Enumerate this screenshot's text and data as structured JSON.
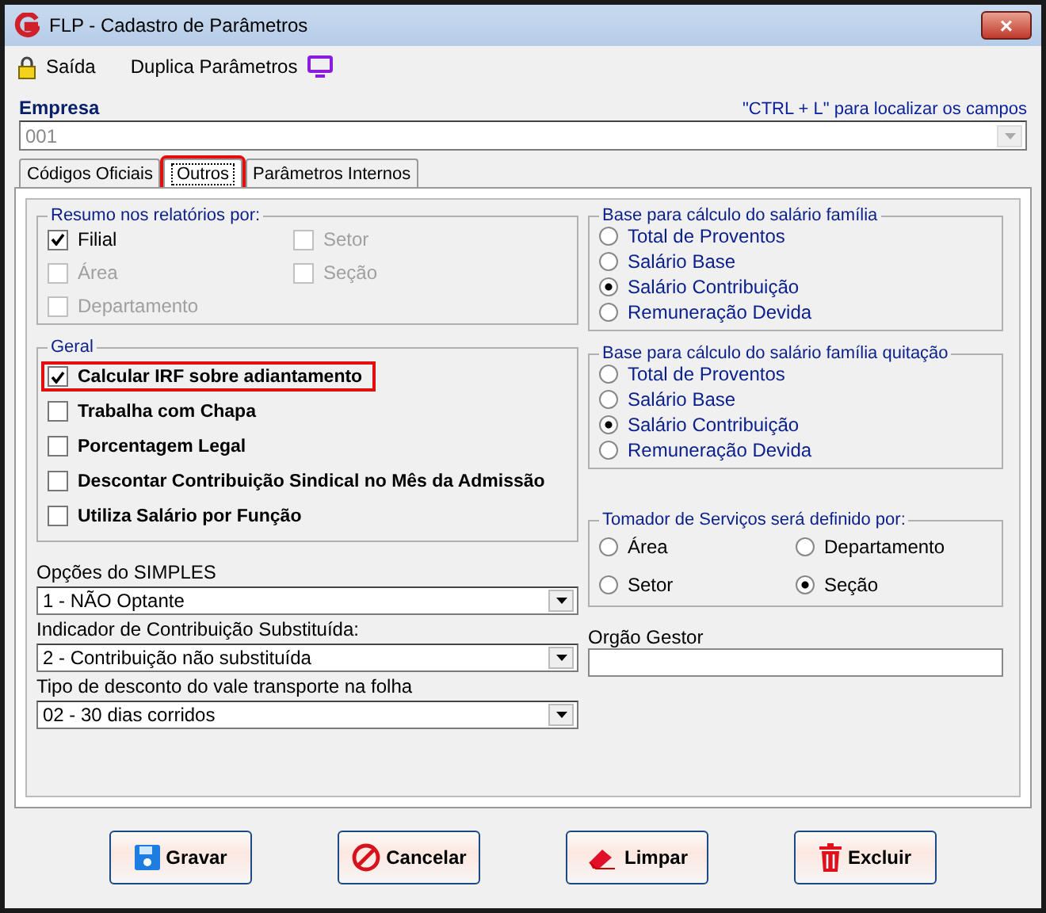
{
  "window": {
    "title": "FLP - Cadastro de Parâmetros",
    "close": "×"
  },
  "toolbar": [
    {
      "label": "Saída",
      "kind": "lock"
    },
    {
      "label": "Duplica Parâmetros",
      "kind": "monitor"
    }
  ],
  "empresa": {
    "label": "Empresa",
    "hint": "\"CTRL + L\" para localizar os campos",
    "value": "001"
  },
  "tabs": [
    {
      "label": "Códigos Oficiais",
      "selected": false,
      "highlighted": false
    },
    {
      "label": "Outros",
      "selected": true,
      "highlighted": true
    },
    {
      "label": "Parâmetros Internos",
      "selected": false,
      "highlighted": false
    }
  ],
  "resumo": {
    "title": "Resumo nos relatórios por:",
    "items": [
      {
        "label": "Filial",
        "checked": true,
        "disabled": false
      },
      {
        "label": "Setor",
        "checked": false,
        "disabled": true
      },
      {
        "label": "Área",
        "checked": false,
        "disabled": true
      },
      {
        "label": "Seção",
        "checked": false,
        "disabled": true
      },
      {
        "label": "Departamento",
        "checked": false,
        "disabled": true
      }
    ]
  },
  "geral": {
    "title": "Geral",
    "items": [
      {
        "label": "Calcular IRF sobre adiantamento",
        "checked": true,
        "highlighted": true
      },
      {
        "label": "Trabalha com Chapa",
        "checked": false,
        "highlighted": false
      },
      {
        "label": "Porcentagem Legal",
        "checked": false,
        "highlighted": false
      },
      {
        "label": "Descontar Contribuição Sindical no Mês da  Admissão",
        "checked": false,
        "highlighted": false
      },
      {
        "label": "Utiliza Salário por Função",
        "checked": false,
        "highlighted": false
      }
    ]
  },
  "dropdowns": [
    {
      "label": "Opções do SIMPLES",
      "value": "1 - NÃO Optante"
    },
    {
      "label": "Indicador de Contribuição Substituída:",
      "value": "2 - Contribuição não substituída"
    },
    {
      "label": "Tipo de desconto do vale transporte na folha",
      "value": "02 - 30 dias corridos"
    }
  ],
  "radio_groups": [
    {
      "title": "Base para cálculo do salário família",
      "kind": "list",
      "options": [
        {
          "label": "Total de Proventos",
          "selected": false
        },
        {
          "label": "Salário Base",
          "selected": false
        },
        {
          "label": "Salário Contribuição",
          "selected": true
        },
        {
          "label": "Remuneração Devida",
          "selected": false
        }
      ]
    },
    {
      "title": "Base para cálculo do salário família quitação",
      "kind": "list",
      "options": [
        {
          "label": "Total de Proventos",
          "selected": false
        },
        {
          "label": "Salário Base",
          "selected": false
        },
        {
          "label": "Salário Contribuição",
          "selected": true
        },
        {
          "label": "Remuneração Devida",
          "selected": false
        }
      ]
    },
    {
      "title": "Tomador de Serviços será definido por:",
      "kind": "grid",
      "options": [
        {
          "label": "Área",
          "selected": false
        },
        {
          "label": "Departamento",
          "selected": false
        },
        {
          "label": "Setor",
          "selected": false
        },
        {
          "label": "Seção",
          "selected": true
        }
      ]
    }
  ],
  "orgao": {
    "label": "Orgão Gestor"
  },
  "buttons": [
    {
      "label": "Gravar",
      "kind": "save"
    },
    {
      "label": "Cancelar",
      "kind": "cancel"
    },
    {
      "label": "Limpar",
      "kind": "eraser"
    },
    {
      "label": "Excluir",
      "kind": "trash"
    }
  ]
}
